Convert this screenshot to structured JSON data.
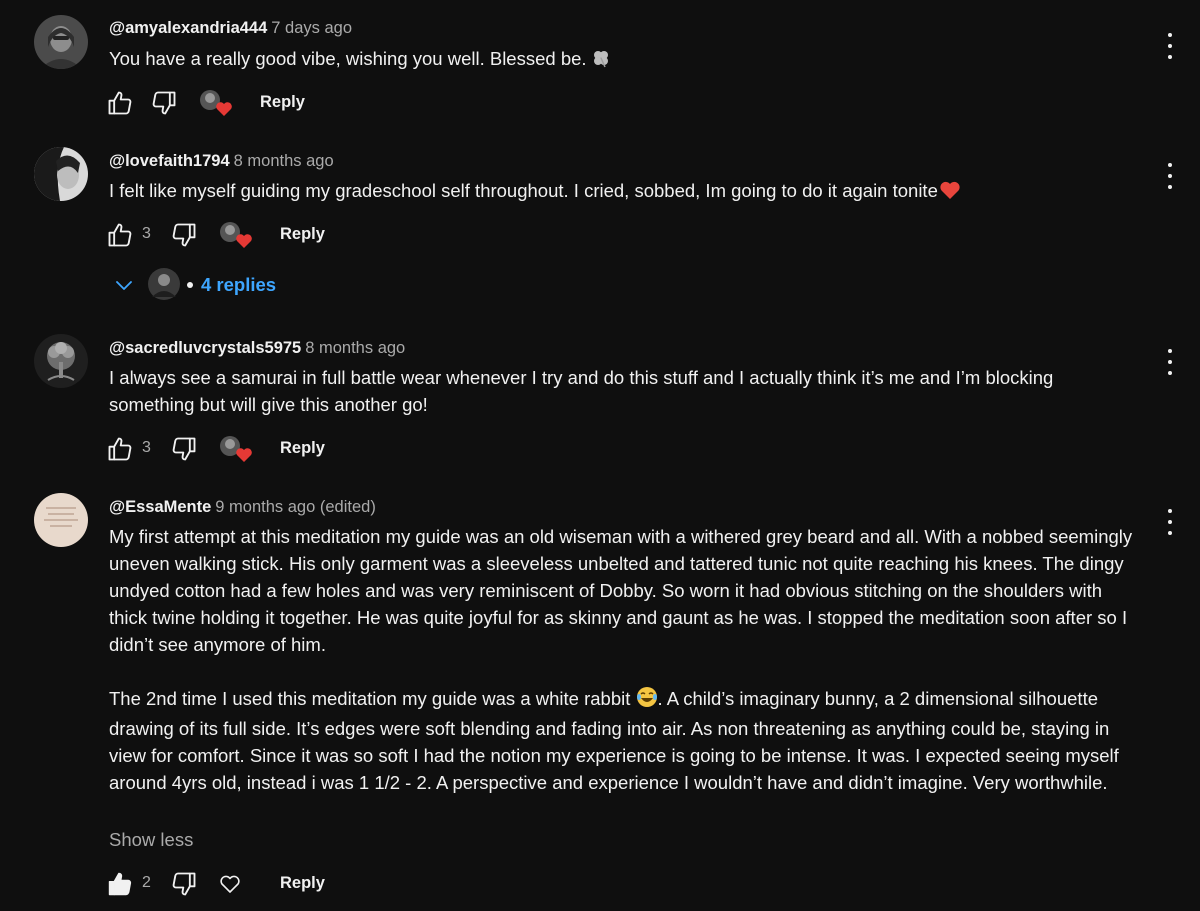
{
  "comments": [
    {
      "author": "@amyalexandria444",
      "time": "7 days ago",
      "text": [
        "You have a really good vibe, wishing you well. Blessed be."
      ],
      "emoji": "four-leaf-clover-icon",
      "likes": "",
      "reply_label": "Reply"
    },
    {
      "author": "@lovefaith1794",
      "time": "8 months ago",
      "text": [
        "I felt like myself guiding my gradeschool self throughout. I cried, sobbed, Im going to do it again tonite"
      ],
      "emoji": "red-heart-icon",
      "likes": "3",
      "reply_label": "Reply",
      "replies_label": "4 replies"
    },
    {
      "author": "@sacredluvcrystals5975",
      "time": "8 months ago",
      "text": [
        "I always see a samurai in full battle wear whenever I try and do this stuff and I actually think it’s me and I’m blocking something but will give this another go!"
      ],
      "likes": "3",
      "reply_label": "Reply"
    },
    {
      "author": "@EssaMente",
      "time": "9 months ago (edited)",
      "text": [
        "My first attempt at this meditation my guide was an old wiseman with a withered grey beard and all. With a nobbed seemingly uneven walking stick. His only garment was a sleeveless unbelted and tattered tunic not quite reaching his knees. The dingy undyed cotton had a few holes and was very reminiscent of Dobby. So worn it had obvious stitching on the shoulders with thick twine holding it together.  He was quite joyful for as skinny and gaunt as he was.    I stopped the meditation soon after so I didn’t see anymore of him.",
        "The 2nd time I used this meditation my guide was a white rabbit",
        ". A child’s imaginary bunny, a 2 dimensional silhouette drawing of its full side. It’s edges were soft blending and fading into air.  As non threatening as anything could be, staying in view for comfort.  Since it was so soft I had the notion my experience is going to be intense. It was. I expected seeing myself around 4yrs old, instead i was 1 1/2 - 2.  A perspective and experience I wouldn’t have and didn’t imagine. Very worthwhile."
      ],
      "emoji": "laughing-tears-icon",
      "show_less": "Show less",
      "likes": "2",
      "reply_label": "Reply"
    }
  ],
  "colors": {
    "background": "#0f0f0f",
    "text": "#f1f1f1",
    "muted": "#aaaaaa",
    "link": "#3ea6ff",
    "heart": "#e53935"
  }
}
